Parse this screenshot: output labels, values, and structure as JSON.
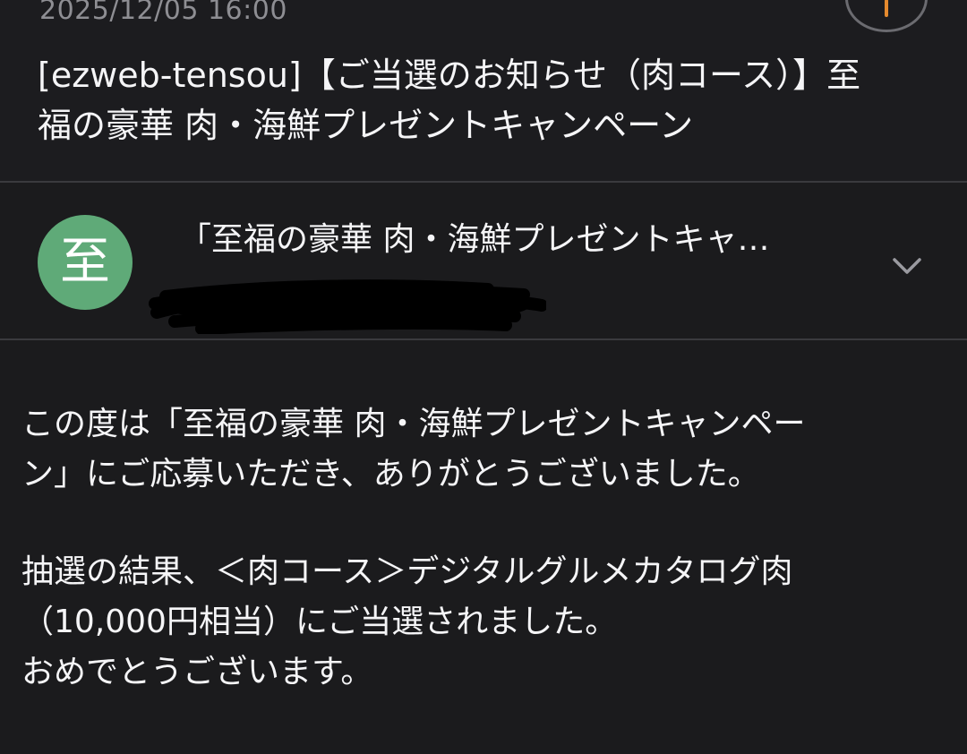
{
  "email": {
    "timestamp": "2025/12/05 16:00",
    "subject_line1": "[ezweb-tensou]【ご当選のお知らせ（肉コース）】至",
    "subject_line2": "福の豪華 肉・海鮮プレゼントキャンペーン",
    "sender": {
      "avatar_letter": "至",
      "avatar_color": "#5faa78",
      "name": "「至福の豪華 肉・海鮮プレゼントキャ…"
    },
    "body": {
      "paragraph1_line1": "この度は「至福の豪華 肉・海鮮プレゼントキャンペー",
      "paragraph1_line2": "ン」にご応募いただき、ありがとうございました。",
      "paragraph2_line1": "抽選の結果、＜肉コース＞デジタルグルメカタログ肉",
      "paragraph2_line2": "（10,000円相当）にご当選されました。",
      "paragraph2_line3": "おめでとうございます。"
    }
  },
  "icons": {
    "expand": "chevron-down-icon",
    "top_action": "reply-icon"
  },
  "colors": {
    "background": "#1b1b1d",
    "divider": "#3a3a3e",
    "accent": "#e58a2e"
  }
}
